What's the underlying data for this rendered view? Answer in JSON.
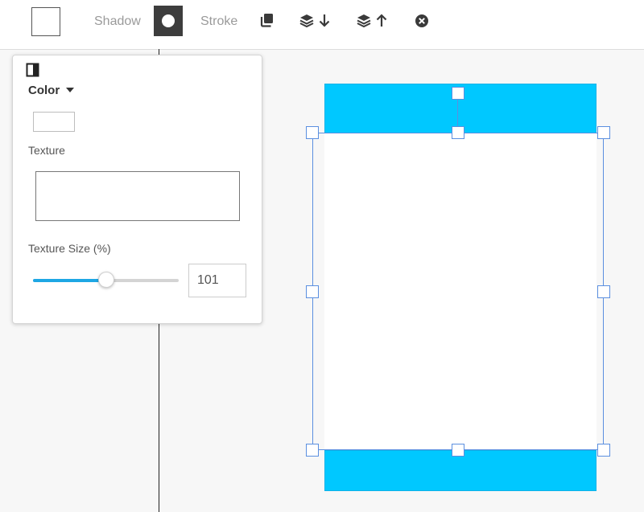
{
  "toolbar": {
    "shadow_label": "Shadow",
    "stroke_label": "Stroke",
    "icons": [
      "fill-swatch",
      "circle-shape-icon",
      "duplicate-icon",
      "layer-down-icon",
      "layer-up-icon",
      "delete-icon"
    ]
  },
  "panel": {
    "toggle_icon": "panel-toggle-icon",
    "color_label": "Color",
    "texture_label": "Texture",
    "texture_size_label": "Texture Size (%)",
    "texture_size_value": "101",
    "texture_size_fraction": 0.5
  },
  "colors": {
    "accent": "#1ea7e4",
    "band": "#00c8ff",
    "selection": "#5b8fe0",
    "active_tool": "#3d3d3d"
  }
}
